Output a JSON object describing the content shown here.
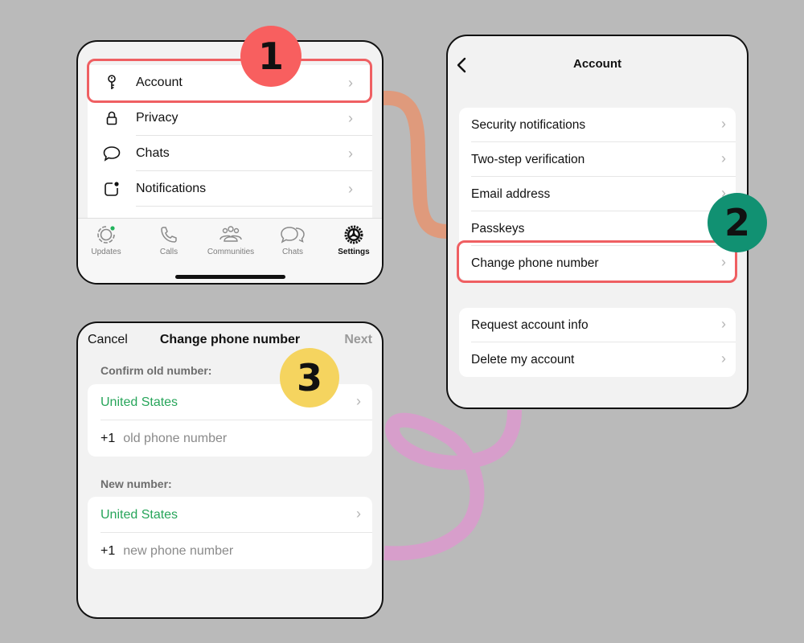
{
  "colors": {
    "background": "#bababa",
    "highlight": "#ef5f62",
    "badge1": "#f85f5f",
    "badge2": "#119172",
    "badge3": "#f5d45f",
    "connector1": "#df9a7c",
    "connector2": "#d79ecb",
    "country_green": "#27a55a"
  },
  "badges": {
    "step1": "1",
    "step2": "2",
    "step3": "3"
  },
  "settings_panel": {
    "items": [
      {
        "label": "Account",
        "icon": "key-icon",
        "highlighted": true
      },
      {
        "label": "Privacy",
        "icon": "lock-icon"
      },
      {
        "label": "Chats",
        "icon": "chat-bubble-icon"
      },
      {
        "label": "Notifications",
        "icon": "notification-badge-icon"
      }
    ],
    "tabs": [
      {
        "label": "Updates",
        "icon": "updates-icon",
        "has_dot": true
      },
      {
        "label": "Calls",
        "icon": "phone-icon"
      },
      {
        "label": "Communities",
        "icon": "communities-icon"
      },
      {
        "label": "Chats",
        "icon": "chats-icon"
      },
      {
        "label": "Settings",
        "icon": "settings-gear-icon",
        "active": true
      }
    ]
  },
  "account_panel": {
    "title": "Account",
    "back_icon": "chevron-left-icon",
    "group1": [
      {
        "label": "Security notifications"
      },
      {
        "label": "Two-step verification"
      },
      {
        "label": "Email address"
      },
      {
        "label": "Passkeys"
      },
      {
        "label": "Change phone number",
        "highlighted": true
      }
    ],
    "group2": [
      {
        "label": "Request account info"
      },
      {
        "label": "Delete my account"
      }
    ]
  },
  "change_number_panel": {
    "cancel_label": "Cancel",
    "title": "Change phone number",
    "next_label": "Next",
    "old_section_label": "Confirm old number:",
    "old_country": "United States",
    "old_code": "+1",
    "old_placeholder": "old phone number",
    "new_section_label": "New number:",
    "new_country": "United States",
    "new_code": "+1",
    "new_placeholder": "new phone number"
  }
}
